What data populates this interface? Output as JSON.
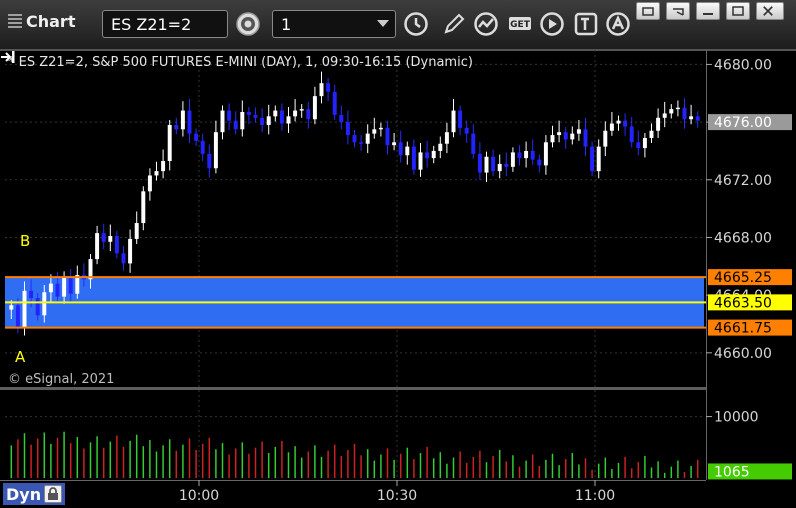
{
  "toolbar": {
    "app_title": "Chart",
    "symbol": "ES Z21=2",
    "interval": "1",
    "icons": [
      "gear-icon",
      "clock-icon",
      "pencil-icon",
      "study-icon",
      "get-icon",
      "play-icon",
      "text-icon",
      "alert-icon"
    ],
    "window_controls": [
      "restore-icon",
      "link-icon",
      "close-icon"
    ]
  },
  "chart": {
    "title": "* ES Z21=2, S&P 500 FUTURES E-MINI (DAY), 1, 09:30-16:15 (Dynamic)",
    "copyright": "© eSignal, 2021",
    "dyn_label": "Dyn",
    "label_a": "A",
    "label_b": "B"
  },
  "chart_data": {
    "type": "candlestick",
    "x_ticks": [
      "10:00",
      "10:30",
      "11:00"
    ],
    "price_ticks": [
      "4680.00",
      "4676.00",
      "4672.00",
      "4668.00",
      "4664.00",
      "4660.00"
    ],
    "volume_ticks": [
      "10000"
    ],
    "current_price": "4676.00",
    "current_volume": "1065",
    "price_levels": [
      {
        "label": "4665.25",
        "value": 4665.25,
        "color": "#ff7f00"
      },
      {
        "label": "4663.50",
        "value": 4663.5,
        "color": "#ffff00"
      },
      {
        "label": "4661.75",
        "value": 4661.75,
        "color": "#ff7f00"
      }
    ],
    "band": {
      "from": 4661.75,
      "to": 4665.25,
      "color": "#2f6ef2"
    },
    "ylim": [
      4657.7,
      4681
    ],
    "closes": [
      4663.3,
      4661.7,
      4664.3,
      4663.8,
      4662.6,
      4664.2,
      4664.8,
      4663.9,
      4665.3,
      4664.1,
      4665.4,
      4665.1,
      4666.5,
      4668.3,
      4667.7,
      4668.1,
      4666.9,
      4666.2,
      4667.9,
      4669.0,
      4671.2,
      4672.3,
      4672.6,
      4673.3,
      4675.8,
      4675.5,
      4676.8,
      4675.2,
      4674.7,
      4673.8,
      4672.8,
      4675.3,
      4676.8,
      4676.1,
      4675.5,
      4676.7,
      4676.5,
      4676.3,
      4675.8,
      4676.4,
      4676.8,
      4675.9,
      4676.4,
      4676.8,
      4676.9,
      4676.2,
      4677.8,
      4678.7,
      4678.1,
      4676.5,
      4676.0,
      4675.1,
      4674.6,
      4674.5,
      4675.2,
      4675.5,
      4675.6,
      4674.4,
      4674.6,
      4673.7,
      4674.3,
      4672.7,
      4673.9,
      4673.5,
      4674.0,
      4674.5,
      4675.3,
      4676.8,
      4675.6,
      4675.2,
      4673.8,
      4672.5,
      4673.6,
      4672.6,
      4673.1,
      4672.9,
      4673.9,
      4673.5,
      4674.0,
      4673.4,
      4673.0,
      4674.6,
      4675.1,
      4675.3,
      4674.8,
      4675.2,
      4675.5,
      4674.3,
      4672.6,
      4674.3,
      4675.4,
      4675.9,
      4676.1,
      4675.7,
      4674.6,
      4674.2,
      4674.9,
      4675.4,
      4676.3,
      4676.6,
      4676.9,
      4677.0,
      4676.2,
      4676.4,
      4676.1
    ]
  }
}
